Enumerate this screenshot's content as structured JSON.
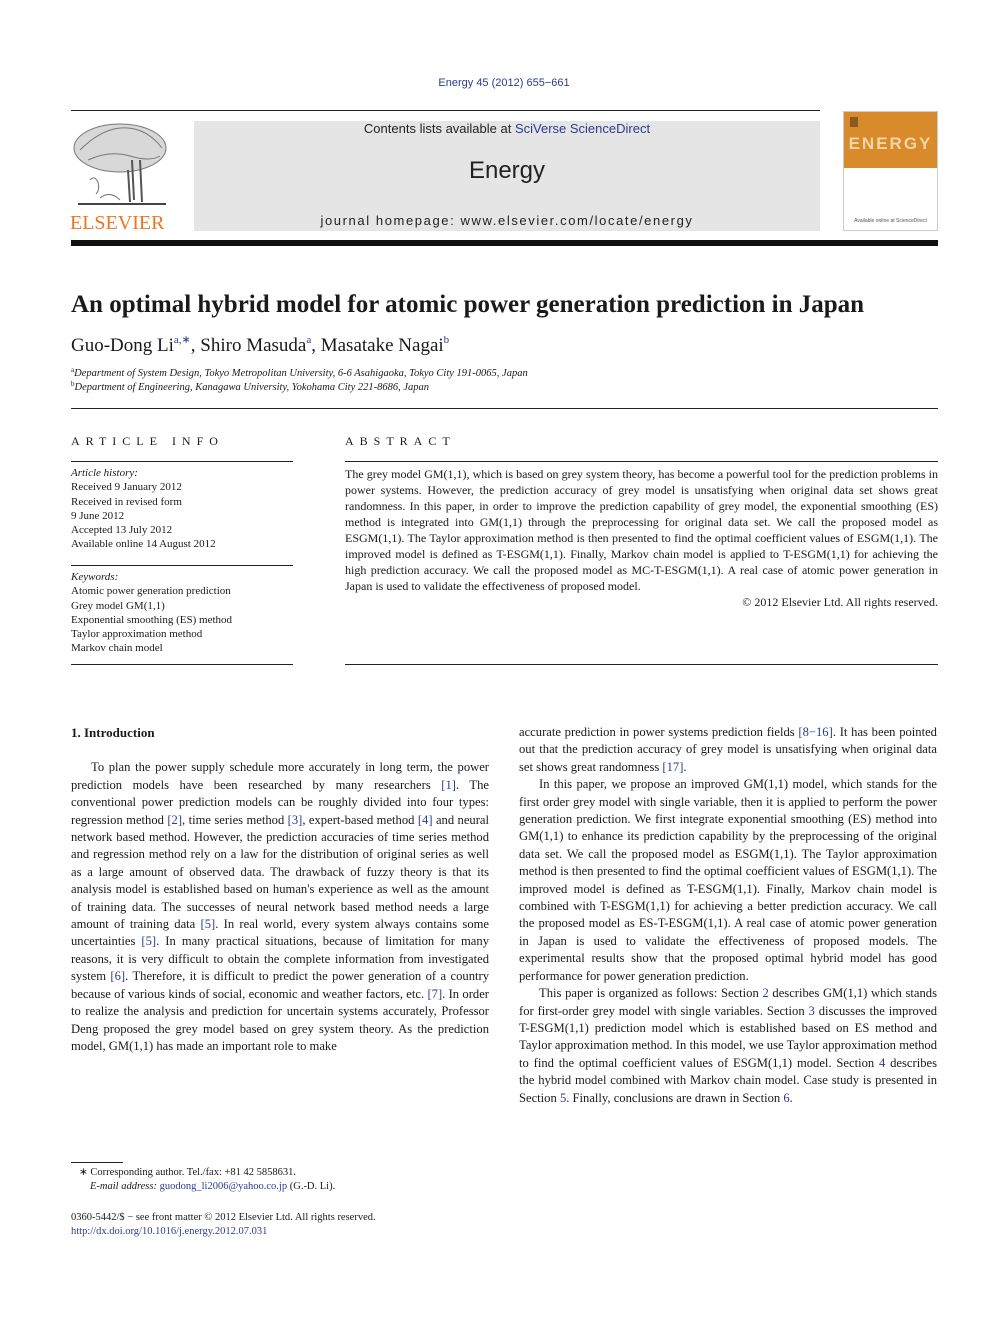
{
  "header": {
    "citation": "Energy 45 (2012) 655−661",
    "contents_prefix": "Contents lists available at ",
    "contents_link": "SciVerse ScienceDirect",
    "journal_name": "Energy",
    "homepage": "journal homepage: www.elsevier.com/locate/energy",
    "publisher_logo_text": "ELSEVIER",
    "cover_title": "ENERGY",
    "cover_footer": "Available online at ScienceDirect"
  },
  "colors": {
    "link": "#2a3c8f",
    "elsevier_orange": "#e87722",
    "cover_orange": "#d98a2b",
    "banner_grey": "#e5e5e5"
  },
  "article": {
    "title": "An optimal hybrid model for atomic power generation prediction in Japan",
    "authors": [
      {
        "name": "Guo-Dong Li",
        "sup": "a,∗",
        "sep": ", "
      },
      {
        "name": "Shiro Masuda",
        "sup": "a",
        "sep": ", "
      },
      {
        "name": "Masatake Nagai",
        "sup": "b",
        "sep": ""
      }
    ],
    "affiliations": [
      {
        "mark": "a",
        "text": "Department of System Design, Tokyo Metropolitan University, 6-6 Asahigaoka, Tokyo City 191-0065, Japan"
      },
      {
        "mark": "b",
        "text": "Department of Engineering, Kanagawa University, Yokohama City 221-8686, Japan"
      }
    ]
  },
  "article_info": {
    "label": "ARTICLE INFO",
    "history_header": "Article history:",
    "history": [
      "Received 9 January 2012",
      "Received in revised form",
      "9 June 2012",
      "Accepted 13 July 2012",
      "Available online 14 August 2012"
    ],
    "keywords_header": "Keywords:",
    "keywords": [
      "Atomic power generation prediction",
      "Grey model GM(1,1)",
      "Exponential smoothing (ES) method",
      "Taylor approximation method",
      "Markov chain model"
    ]
  },
  "abstract": {
    "label": "ABSTRACT",
    "text": "The grey model GM(1,1), which is based on grey system theory, has become a powerful tool for the prediction problems in power systems. However, the prediction accuracy of grey model is unsatisfying when original data set shows great randomness. In this paper, in order to improve the prediction capability of grey model, the exponential smoothing (ES) method is integrated into GM(1,1) through the preprocessing for original data set. We call the proposed model as ESGM(1,1). The Taylor approximation method is then presented to find the optimal coefficient values of ESGM(1,1). The improved model is defined as T-ESGM(1,1). Finally, Markov chain model is applied to T-ESGM(1,1) for achieving the high prediction accuracy. We call the proposed model as MC-T-ESGM(1,1). A real case of atomic power generation in Japan is used to validate the effectiveness of proposed model.",
    "copyright": "© 2012 Elsevier Ltd. All rights reserved."
  },
  "body": {
    "section_heading": "1.  Introduction",
    "left_p1": [
      {
        "t": "To plan the power supply schedule more accurately in long term, the power prediction models have been researched by many researchers "
      },
      {
        "ref": "[1]"
      },
      {
        "t": ". The conventional power prediction models can be roughly divided into four types: regression method "
      },
      {
        "ref": "[2]"
      },
      {
        "t": ", time series method "
      },
      {
        "ref": "[3]"
      },
      {
        "t": ", expert-based method "
      },
      {
        "ref": "[4]"
      },
      {
        "t": " and neural network based method. However, the prediction accuracies of time series method and regression method rely on a law for the distribution of original series as well as a large amount of observed data. The drawback of fuzzy theory is that its analysis model is established based on human's experience as well as the amount of training data. The successes of neural network based method needs a large amount of training data "
      },
      {
        "ref": "[5]"
      },
      {
        "t": ". In real world, every system always contains some uncertainties "
      },
      {
        "ref": "[5]"
      },
      {
        "t": ". In many practical situations, because of limitation for many reasons, it is very difficult to obtain the complete information from investigated system "
      },
      {
        "ref": "[6]"
      },
      {
        "t": ". Therefore, it is difficult to predict the power generation of a country because of various kinds of social, economic and weather factors, etc. "
      },
      {
        "ref": "[7]"
      },
      {
        "t": ". In order to realize the analysis and prediction for uncertain systems accurately, Professor Deng proposed the grey model based on grey system theory. As the prediction model, GM(1,1) has made an important role to make"
      }
    ],
    "right_p0": [
      {
        "t": "accurate prediction in power systems prediction fields "
      },
      {
        "ref": "[8−16]"
      },
      {
        "t": ". It has been pointed out that the prediction accuracy of grey model is unsatisfying when original data set shows great randomness "
      },
      {
        "ref": "[17]"
      },
      {
        "t": "."
      }
    ],
    "right_p1": [
      {
        "t": "In this paper, we propose an improved GM(1,1) model, which stands for the first order grey model with single variable, then it is applied to perform the power generation prediction. We first integrate exponential smoothing (ES) method into GM(1,1) to enhance its prediction capability by the preprocessing of the original data set. We call the proposed model as ESGM(1,1). The Taylor approximation method is then presented to find the optimal coefficient values of ESGM(1,1). The improved model is defined as T-ESGM(1,1). Finally, Markov chain model is combined with T-ESGM(1,1) for achieving a better prediction accuracy. We call the proposed model as ES-T-ESGM(1,1). A real case of atomic power generation in Japan is used to validate the effectiveness of proposed models. The experimental results show that the proposed optimal hybrid model has good performance for power generation prediction."
      }
    ],
    "right_p2": [
      {
        "t": "This paper is organized as follows: Section "
      },
      {
        "ref": "2"
      },
      {
        "t": " describes GM(1,1) which stands for first-order grey model with single variables. Section "
      },
      {
        "ref": "3"
      },
      {
        "t": " discusses the improved T-ESGM(1,1) prediction model which is established based on ES method and Taylor approximation method. In this model, we use Taylor approximation method to find the optimal coefficient values of ESGM(1,1) model. Section "
      },
      {
        "ref": "4"
      },
      {
        "t": " describes the hybrid model combined with Markov chain model. Case study is presented in Section "
      },
      {
        "ref": "5"
      },
      {
        "t": ". Finally, conclusions are drawn in Section "
      },
      {
        "ref": "6"
      },
      {
        "t": "."
      }
    ]
  },
  "footnotes": {
    "corresponding": "∗  Corresponding author. Tel./fax: +81 42 5858631.",
    "email_label": "E-mail address: ",
    "email": "guodong_li2006@yahoo.co.jp",
    "email_suffix": " (G.-D. Li).",
    "issn": "0360-5442/$ − see front matter © 2012 Elsevier Ltd. All rights reserved.",
    "doi": "http://dx.doi.org/10.1016/j.energy.2012.07.031"
  }
}
